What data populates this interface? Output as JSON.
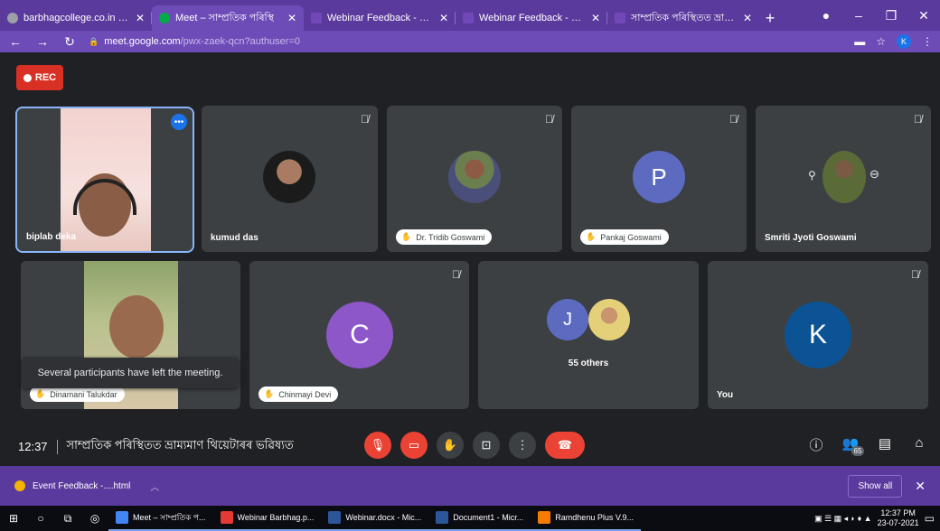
{
  "browser": {
    "tabs": [
      {
        "title": "barbhagcollege.co.in – Calen",
        "active": false,
        "fav_color": "#9aa0a6"
      },
      {
        "title": "Meet – সাম্প্ৰতিক পৰিস্থি",
        "active": true,
        "fav_color": "#00ac47"
      },
      {
        "title": "Webinar Feedback - Google",
        "active": false,
        "fav_color": "#7248b9"
      },
      {
        "title": "Webinar Feedback - Google",
        "active": false,
        "fav_color": "#7248b9"
      },
      {
        "title": "সাম্প্ৰতিক পৰিস্থিতত ভ্ৰাম্যমাণ",
        "active": false,
        "fav_color": "#7248b9"
      }
    ],
    "new_tab": "+",
    "url_host": "meet.google.com",
    "url_path": "/pwx-zaek-qcn?authuser=0",
    "profile_initial": "K"
  },
  "meet": {
    "rec_label": "REC",
    "tiles": [
      {
        "name": "biplab deka",
        "type": "video"
      },
      {
        "name": "kumud das",
        "type": "photo"
      },
      {
        "name": "Dr. Tridib Goswami",
        "type": "photo"
      },
      {
        "name": "Pankaj Goswami",
        "type": "letter",
        "letter": "P",
        "color": "#5c6bc0"
      },
      {
        "name": "Smriti Jyoti Goswami",
        "type": "photo"
      },
      {
        "name": "Dinamani Talukdar",
        "type": "video"
      },
      {
        "name": "Chinmayi Devi",
        "type": "letter",
        "letter": "C",
        "color": "#8e57c9"
      },
      {
        "name": "55 others",
        "type": "group",
        "letter": "J",
        "color": "#5c6bc0"
      },
      {
        "name": "You",
        "type": "letter",
        "letter": "K",
        "color": "#0b5394"
      }
    ],
    "toast": "Several participants have left the meeting.",
    "time": "12:37",
    "meeting_title": "সাম্প্ৰতিক পৰিস্থিতত ভ্ৰাম্যমাণ থিয়েটাৰৰ ভৱিষ্যত",
    "participant_count": "65"
  },
  "downloads": {
    "file": "Event Feedback -....html",
    "show_all": "Show all"
  },
  "taskbar": {
    "apps": [
      {
        "label": "Meet – সাম্প্ৰতিক প...",
        "color": "#4285f4"
      },
      {
        "label": "Webinar Barbhag.p...",
        "color": "#e53935"
      },
      {
        "label": "Webinar.docx - Mic...",
        "color": "#2b579a"
      },
      {
        "label": "Document1 - Micr...",
        "color": "#2b579a"
      },
      {
        "label": "Ramdhenu Plus V.9...",
        "color": "#f57c00"
      }
    ],
    "time": "12:37 PM",
    "date": "23-07-2021"
  }
}
